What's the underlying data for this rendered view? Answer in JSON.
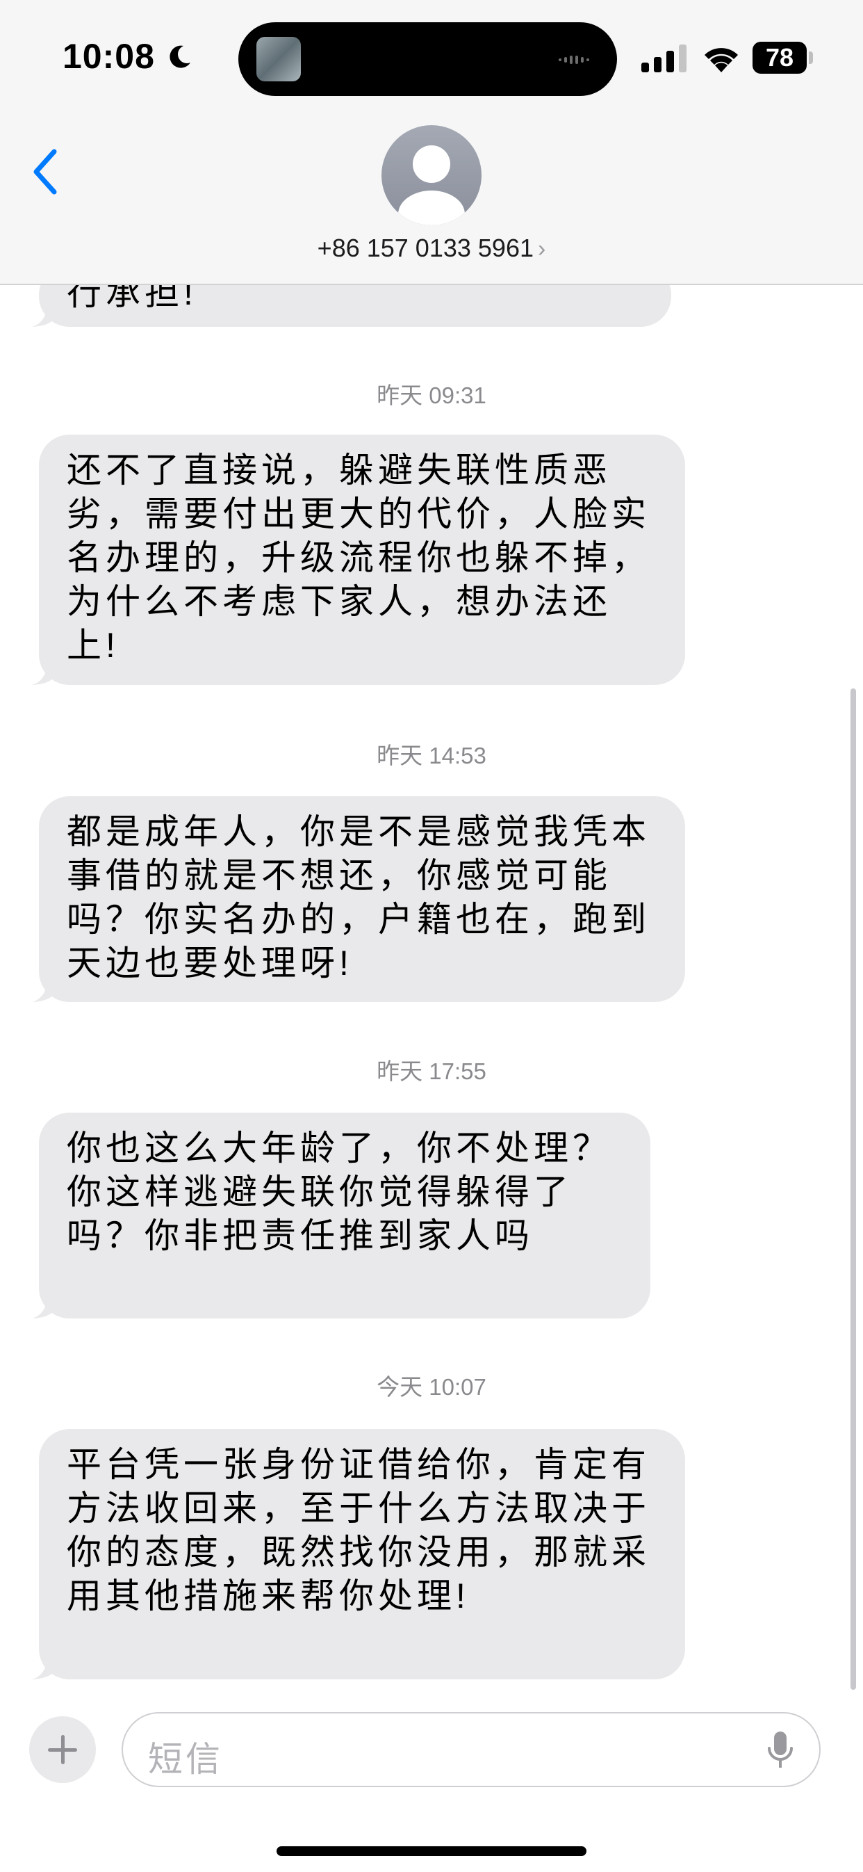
{
  "status_bar": {
    "time": "10:08",
    "battery": "78"
  },
  "header": {
    "contact": "+86 157 0133 5961",
    "chevron": "›"
  },
  "messages": [
    {
      "type": "bubble",
      "text": "行承担!"
    },
    {
      "type": "timestamp",
      "text": "昨天 09:31"
    },
    {
      "type": "bubble",
      "text": "还不了直接说，躲避失联性质恶劣，需要付出更大的代价，人脸实名办理的，升级流程你也躲不掉，为什么不考虑下家人，想办法还上!"
    },
    {
      "type": "timestamp",
      "text": "昨天 14:53"
    },
    {
      "type": "bubble",
      "text": "都是成年人，你是不是感觉我凭本事借的就是不想还，你感觉可能吗？你实名办的，户籍也在，跑到天边也要处理呀!"
    },
    {
      "type": "timestamp",
      "text": "昨天 17:55"
    },
    {
      "type": "bubble",
      "text": "你也这么大年龄了，你不处理？你这样逃避失联你觉得躲得了吗？你非把责任推到家人吗"
    },
    {
      "type": "timestamp",
      "text": "今天 10:07"
    },
    {
      "type": "bubble",
      "text": "平台凭一张身份证借给你，肯定有方法收回来，至于什么方法取决于你的态度，既然找你没用，那就采用其他措施来帮你处理!"
    }
  ],
  "input": {
    "placeholder": "短信"
  },
  "icons": {
    "back": "chevron-left-icon",
    "avatar": "person-icon",
    "plus": "plus-icon",
    "mic": "microphone-icon",
    "moon": "moon-icon",
    "signal": "cellular-signal-icon",
    "wifi": "wifi-icon"
  },
  "colors": {
    "accent": "#007aff",
    "bubble": "#e9e9eb",
    "timestamp": "#8a8a8e"
  }
}
